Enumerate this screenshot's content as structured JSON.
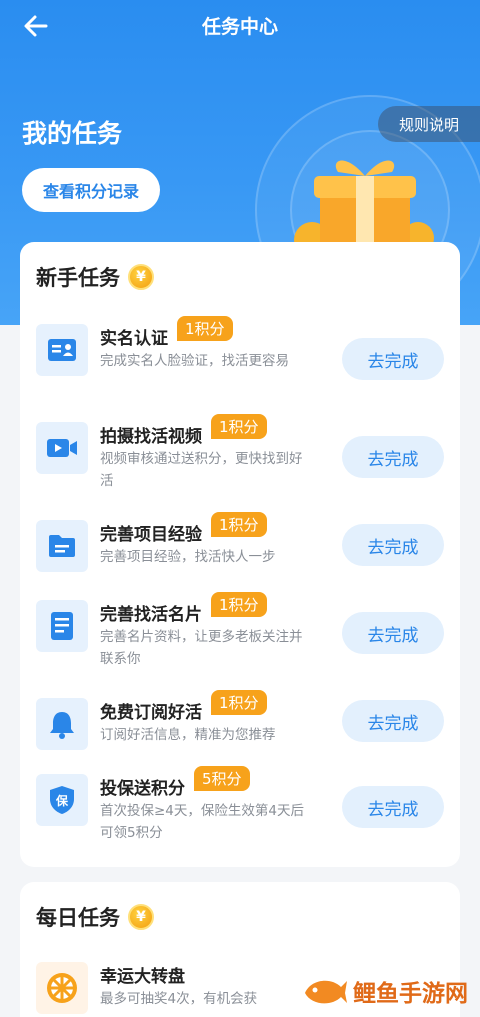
{
  "header": {
    "title": "任务中心"
  },
  "hero": {
    "title": "我的任务",
    "points_button": "查看积分记录",
    "rules_button": "规则说明"
  },
  "newbie": {
    "title": "新手任务",
    "coin": "¥",
    "tasks": [
      {
        "name": "实名认证",
        "badge": "1积分",
        "desc": "完成实名人脸验证，找活更容易",
        "action": "去完成",
        "icon": "id-card-icon"
      },
      {
        "name": "拍摄找活视频",
        "badge": "1积分",
        "desc": "视频审核通过送积分，更快找到好活",
        "action": "去完成",
        "icon": "video-camera-icon"
      },
      {
        "name": "完善项目经验",
        "badge": "1积分",
        "desc": "完善项目经验，找活快人一步",
        "action": "去完成",
        "icon": "folder-icon"
      },
      {
        "name": "完善找活名片",
        "badge": "1积分",
        "desc": "完善名片资料，让更多老板关注并联系你",
        "action": "去完成",
        "icon": "document-icon"
      },
      {
        "name": "免费订阅好活",
        "badge": "1积分",
        "desc": "订阅好活信息，精准为您推荐",
        "action": "去完成",
        "icon": "bell-icon"
      },
      {
        "name": "投保送积分",
        "badge": "5积分",
        "desc": "首次投保≥4天，保险生效第4天后可领5积分",
        "action": "去完成",
        "icon": "shield-icon"
      }
    ]
  },
  "daily": {
    "title": "每日任务",
    "coin": "¥",
    "tasks": [
      {
        "name": "幸运大转盘",
        "desc": "最多可抽奖4次，有机会获",
        "icon": "wheel-icon"
      }
    ]
  },
  "watermark": {
    "text": "鲤鱼手游网"
  },
  "colors": {
    "primary": "#2a86e8",
    "badge": "#f7a21b",
    "button_bg": "#e3f0fd"
  }
}
